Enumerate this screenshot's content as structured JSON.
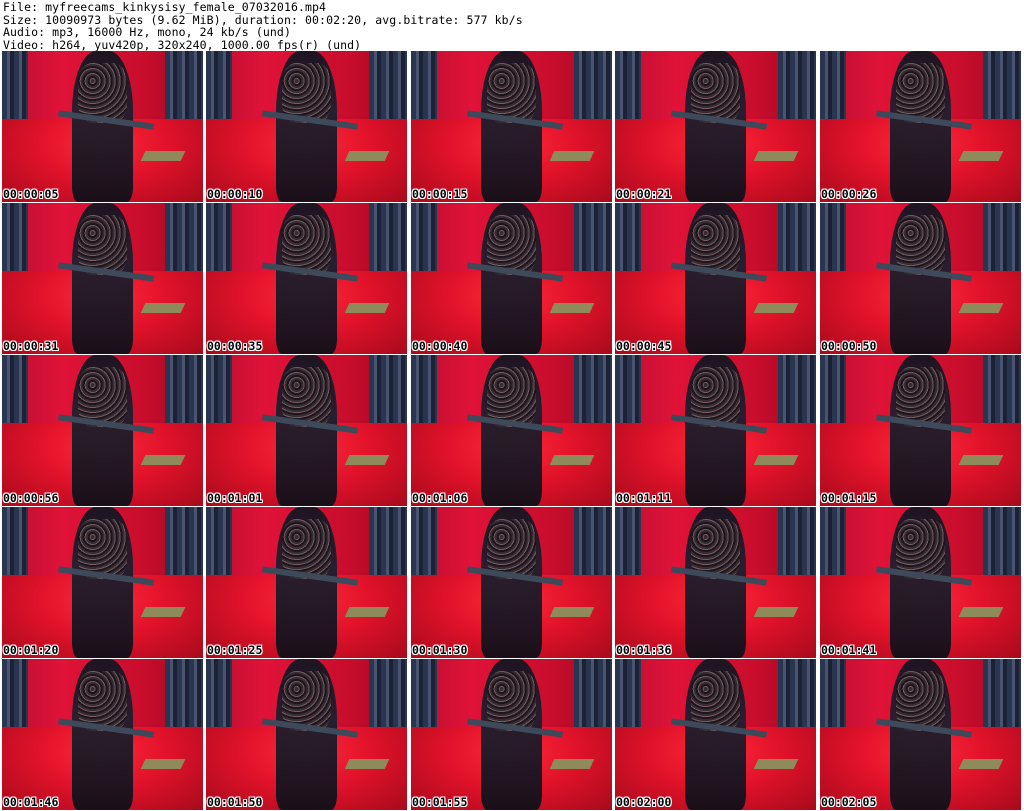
{
  "header": {
    "file_line": "File: myfreecams_kinkysisy_female_07032016.mp4",
    "size_line": "Size: 10090973 bytes (9.62 MiB), duration: 00:02:20, avg.bitrate: 577 kb/s",
    "audio_line": "Audio: mp3, 16000 Hz, mono, 24 kb/s (und)",
    "video_line": "Video: h264, yuv420p, 320x240, 1000.00 fps(r) (und)"
  },
  "thumbnails": [
    {
      "time": "00:00:05"
    },
    {
      "time": "00:00:10"
    },
    {
      "time": "00:00:15"
    },
    {
      "time": "00:00:21"
    },
    {
      "time": "00:00:26"
    },
    {
      "time": "00:00:31"
    },
    {
      "time": "00:00:35"
    },
    {
      "time": "00:00:40"
    },
    {
      "time": "00:00:45"
    },
    {
      "time": "00:00:50"
    },
    {
      "time": "00:00:56"
    },
    {
      "time": "00:01:01"
    },
    {
      "time": "00:01:06"
    },
    {
      "time": "00:01:11"
    },
    {
      "time": "00:01:15"
    },
    {
      "time": "00:01:20"
    },
    {
      "time": "00:01:25"
    },
    {
      "time": "00:01:30"
    },
    {
      "time": "00:01:36"
    },
    {
      "time": "00:01:41"
    },
    {
      "time": "00:01:46"
    },
    {
      "time": "00:01:50"
    },
    {
      "time": "00:01:55"
    },
    {
      "time": "00:02:00"
    },
    {
      "time": "00:02:05"
    }
  ]
}
